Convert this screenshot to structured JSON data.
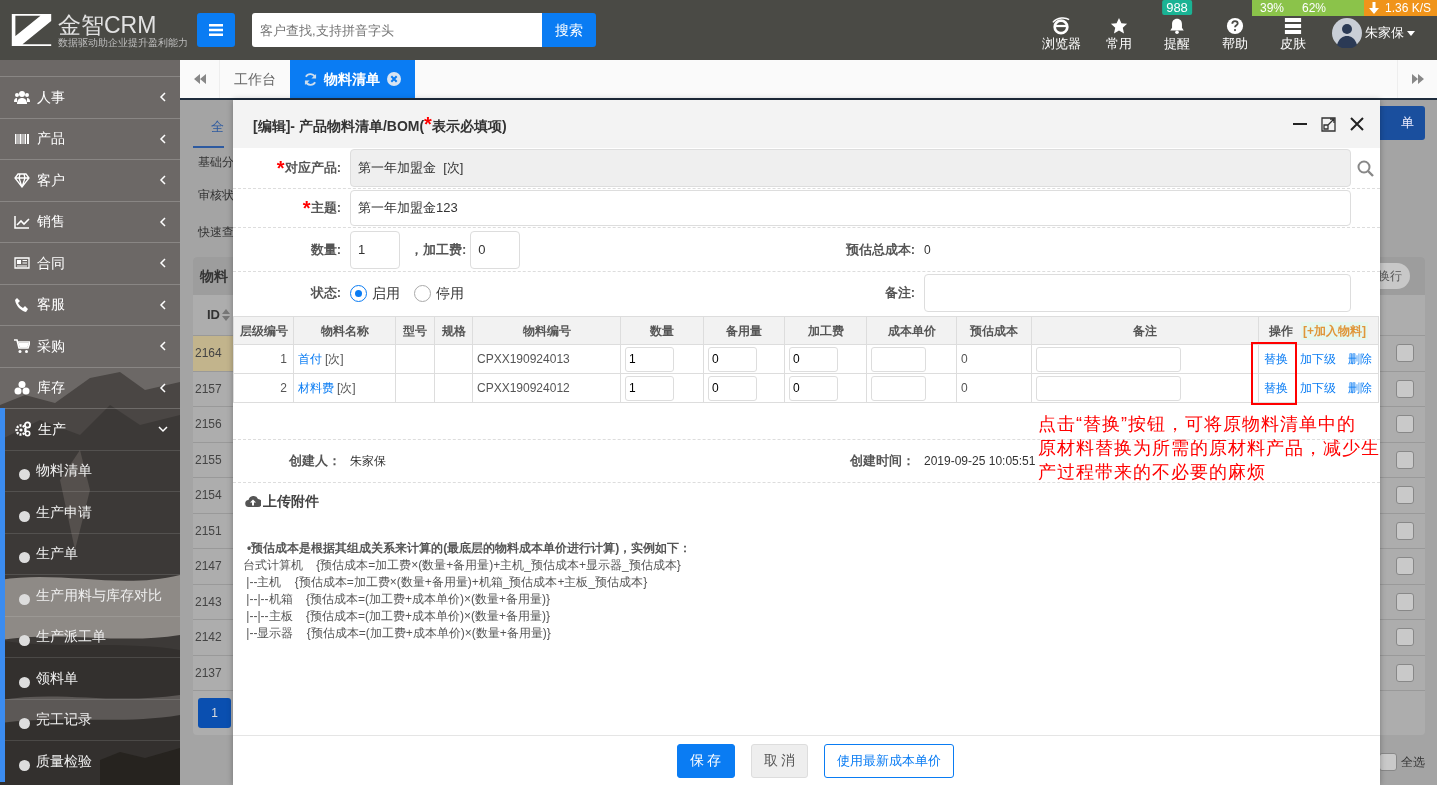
{
  "header": {
    "logo": {
      "name": "金智CRM",
      "slogan": "数据驱动助企业提升盈利能力"
    },
    "search": {
      "placeholder": "客户查找,支持拼音字头",
      "button": "搜索"
    },
    "tools": [
      {
        "label": "浏览器"
      },
      {
        "label": "常用"
      },
      {
        "label": "提醒",
        "badge": "988"
      },
      {
        "label": "帮助"
      },
      {
        "label": "皮肤"
      }
    ],
    "user": {
      "name": "朱家保"
    },
    "monitor": {
      "cpu": "39%",
      "memory": "62%",
      "speed": "1.36 K/S"
    }
  },
  "sidebar": {
    "items": [
      {
        "label": "人事",
        "expanded": false
      },
      {
        "label": "产品",
        "expanded": false
      },
      {
        "label": "客户",
        "expanded": false
      },
      {
        "label": "销售",
        "expanded": false
      },
      {
        "label": "合同",
        "expanded": false
      },
      {
        "label": "客服",
        "expanded": false
      },
      {
        "label": "采购",
        "expanded": false
      },
      {
        "label": "库存",
        "expanded": false
      },
      {
        "label": "生产",
        "expanded": true,
        "children": [
          {
            "label": "物料清单"
          },
          {
            "label": "生产申请"
          },
          {
            "label": "生产单"
          },
          {
            "label": "生产用料与库存对比"
          },
          {
            "label": "生产派工单"
          },
          {
            "label": "领料单"
          },
          {
            "label": "完工记录"
          },
          {
            "label": "质量检验"
          }
        ]
      }
    ]
  },
  "tabs": [
    {
      "label": "工作台",
      "selected": false
    },
    {
      "label": "物料清单",
      "selected": true
    }
  ],
  "page": {
    "tab": "全",
    "top_button": "单",
    "filters": [
      "基础分",
      "审核状",
      "快速查"
    ],
    "panel_title": "物料",
    "wrap_button": "换行",
    "id_header": "ID",
    "rows": [
      {
        "id": "2164",
        "selected": true,
        "checked": false
      },
      {
        "id": "2157",
        "selected": false,
        "checked": false
      },
      {
        "id": "2156",
        "selected": false,
        "checked": false
      },
      {
        "id": "2155",
        "selected": false,
        "checked": false
      },
      {
        "id": "2154",
        "selected": false,
        "checked": false
      },
      {
        "id": "2151",
        "selected": false,
        "checked": false
      },
      {
        "id": "2147",
        "selected": false,
        "checked": false
      },
      {
        "id": "2143",
        "selected": false,
        "checked": false
      },
      {
        "id": "2142",
        "selected": false,
        "checked": false
      },
      {
        "id": "2137",
        "selected": false,
        "checked": false
      }
    ],
    "pagination": [
      {
        "label": "1",
        "selected": true
      }
    ],
    "select_all": {
      "label": "全选",
      "checked": false
    }
  },
  "modal": {
    "title": "[编辑]- 产品物料清单/BOM(",
    "title_mark": "*",
    "title_end": "表示必填项)",
    "product": {
      "required_mark": "*",
      "label": "对应产品:",
      "value": "第一年加盟金  [次]"
    },
    "subject": {
      "required_mark": "*",
      "label": "主题:",
      "value": "第一年加盟金123"
    },
    "quantity": {
      "label": "数量:",
      "value": "1"
    },
    "fee": {
      "label": "，加工费:",
      "value": "0"
    },
    "total_cost": {
      "label": "预估总成本:",
      "value": "0"
    },
    "status": {
      "label": "状态:",
      "options": [
        {
          "label": "启用",
          "selected": true
        },
        {
          "label": "停用",
          "selected": false
        }
      ]
    },
    "remark": {
      "label": "备注:"
    },
    "table": {
      "columns": [
        "层级编号",
        "物料名称",
        "型号",
        "规格",
        "物料编号",
        "数量",
        "备用量",
        "加工费",
        "成本单价",
        "预估成本",
        "备注"
      ],
      "action_header": "操作",
      "add_link": "[+加入物料]",
      "rows": [
        {
          "level": "1",
          "name": "首付",
          "unit": "[次]",
          "code": "CPXX190924013",
          "quantity": "1",
          "spare": "0",
          "fee": "0",
          "est_cost": "0",
          "actions": [
            "替换",
            "加下级",
            "删除"
          ]
        },
        {
          "level": "2",
          "name": "材料费",
          "unit": "[次]",
          "code": "CPXX190924012",
          "quantity": "1",
          "spare": "0",
          "fee": "0",
          "est_cost": "0",
          "actions": [
            "替换",
            "加下级",
            "删除"
          ]
        }
      ]
    },
    "annotation": {
      "lines": [
        "点击“替换”按钮，可将原物料清单中的",
        "原材料替换为所需的原材料产品，减少生",
        "产过程带来的不必要的麻烦"
      ]
    },
    "creator": {
      "label": "创建人：",
      "value": "朱家保"
    },
    "created": {
      "label": "创建时间：",
      "value": "2019-09-25 10:05:51"
    },
    "upload": "上传附件",
    "notes": {
      "heading": "•预估成本是根据其组成关系来计算的(最底层的物料成本单价进行计算)，实例如下：",
      "lines": [
        "台式计算机    {预估成本=加工费×(数量+备用量)+主机_预估成本+显示器_预估成本}",
        " |--主机    {预估成本=加工费×(数量+备用量)+机箱_预估成本+主板_预估成本}",
        " |--|--机箱    {预估成本=(加工费+成本单价)×(数量+备用量)}",
        " |--|--主板    {预估成本=(加工费+成本单价)×(数量+备用量)}",
        " |--显示器    {预估成本=(加工费+成本单价)×(数量+备用量)}"
      ]
    },
    "buttons": [
      {
        "label": "保 存",
        "kind": "primary"
      },
      {
        "label": "取 消",
        "kind": "secondary"
      },
      {
        "label": "使用最新成本单价",
        "kind": "outline"
      }
    ]
  }
}
